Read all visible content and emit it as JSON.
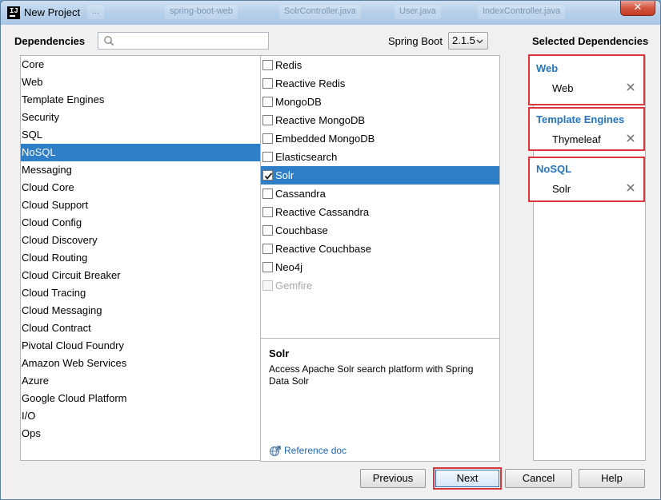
{
  "window": {
    "title": "New Project",
    "close_label": "✕",
    "background_tabs": [
      "...",
      "spring-boot-web",
      "SolrController.java",
      "User.java",
      "IndexController.java"
    ]
  },
  "header": {
    "dependencies_label": "Dependencies",
    "search_placeholder": "",
    "spring_boot_label": "Spring Boot",
    "spring_boot_version": "2.1.5"
  },
  "categories": {
    "selected": "NoSQL",
    "items": [
      "Core",
      "Web",
      "Template Engines",
      "Security",
      "SQL",
      "NoSQL",
      "Messaging",
      "Cloud Core",
      "Cloud Support",
      "Cloud Config",
      "Cloud Discovery",
      "Cloud Routing",
      "Cloud Circuit Breaker",
      "Cloud Tracing",
      "Cloud Messaging",
      "Cloud Contract",
      "Pivotal Cloud Foundry",
      "Amazon Web Services",
      "Azure",
      "Google Cloud Platform",
      "I/O",
      "Ops"
    ]
  },
  "dependencies": {
    "items": [
      {
        "label": "Redis",
        "checked": false,
        "selected": false,
        "disabled": false
      },
      {
        "label": "Reactive Redis",
        "checked": false,
        "selected": false,
        "disabled": false
      },
      {
        "label": "MongoDB",
        "checked": false,
        "selected": false,
        "disabled": false
      },
      {
        "label": "Reactive MongoDB",
        "checked": false,
        "selected": false,
        "disabled": false
      },
      {
        "label": "Embedded MongoDB",
        "checked": false,
        "selected": false,
        "disabled": false
      },
      {
        "label": "Elasticsearch",
        "checked": false,
        "selected": false,
        "disabled": false
      },
      {
        "label": "Solr",
        "checked": true,
        "selected": true,
        "disabled": false
      },
      {
        "label": "Cassandra",
        "checked": false,
        "selected": false,
        "disabled": false
      },
      {
        "label": "Reactive Cassandra",
        "checked": false,
        "selected": false,
        "disabled": false
      },
      {
        "label": "Couchbase",
        "checked": false,
        "selected": false,
        "disabled": false
      },
      {
        "label": "Reactive Couchbase",
        "checked": false,
        "selected": false,
        "disabled": false
      },
      {
        "label": "Neo4j",
        "checked": false,
        "selected": false,
        "disabled": false
      },
      {
        "label": "Gemfire",
        "checked": false,
        "selected": false,
        "disabled": true
      }
    ]
  },
  "description": {
    "title": "Solr",
    "text": "Access Apache Solr search platform with Spring Data Solr",
    "reference_link": "Reference doc",
    "reference_icon": "web-link-icon"
  },
  "selected_dependencies": {
    "title": "Selected Dependencies",
    "remove_icon": "close-icon",
    "groups": [
      {
        "name": "Web",
        "item": "Web"
      },
      {
        "name": "Template Engines",
        "item": "Thymeleaf"
      },
      {
        "name": "NoSQL",
        "item": "Solr"
      }
    ]
  },
  "footer": {
    "previous_label": "Previous",
    "next_label": "Next",
    "cancel_label": "Cancel",
    "help_label": "Help"
  },
  "colors": {
    "selection": "#2f7fc8",
    "group_title": "#2474c0",
    "highlight_border": "#d9363e",
    "link": "#1f64b8"
  }
}
